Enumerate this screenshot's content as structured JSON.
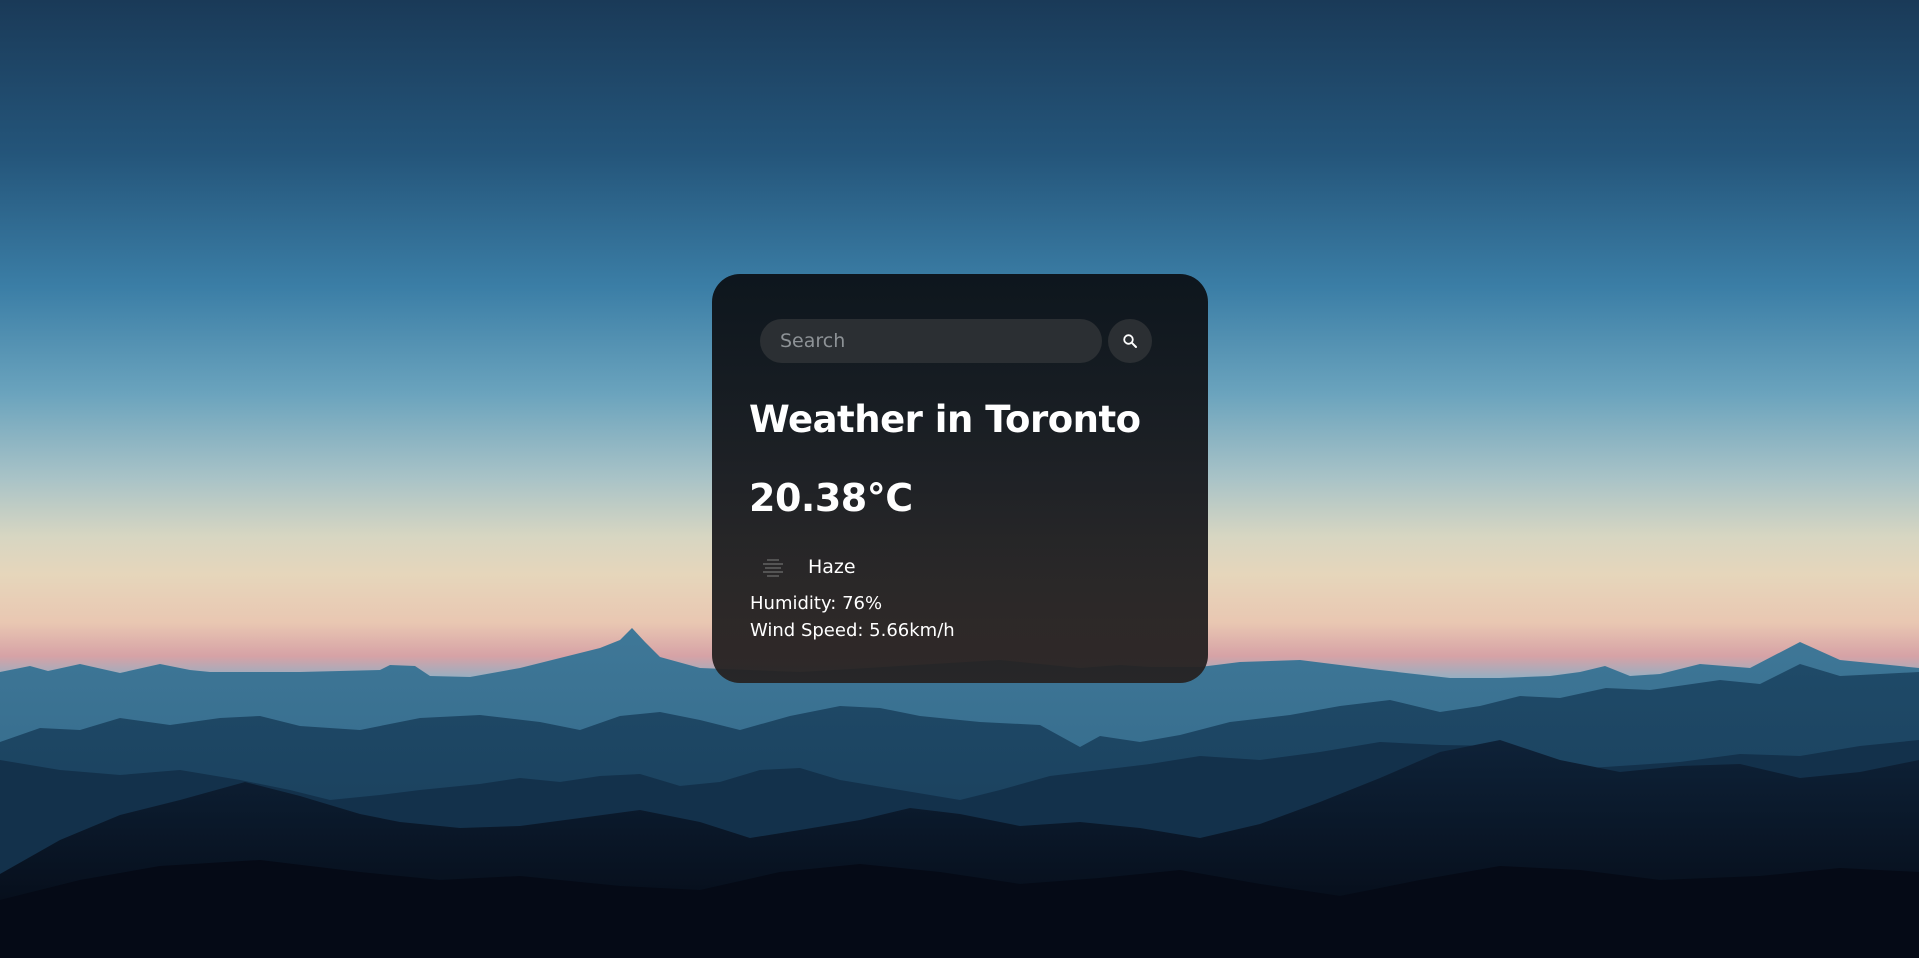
{
  "search": {
    "placeholder": "Search",
    "value": "",
    "button_icon": "search-icon"
  },
  "weather": {
    "title": "Weather in Toronto",
    "temperature": "20.38°C",
    "condition_icon": "haze-icon",
    "description": "Haze",
    "humidity": "Humidity: 76%",
    "wind": "Wind Speed: 5.66km/h"
  },
  "colors": {
    "card_background": "#15191d",
    "input_background": "#2b2f33",
    "text": "#ffffff",
    "placeholder": "#8d9296"
  }
}
